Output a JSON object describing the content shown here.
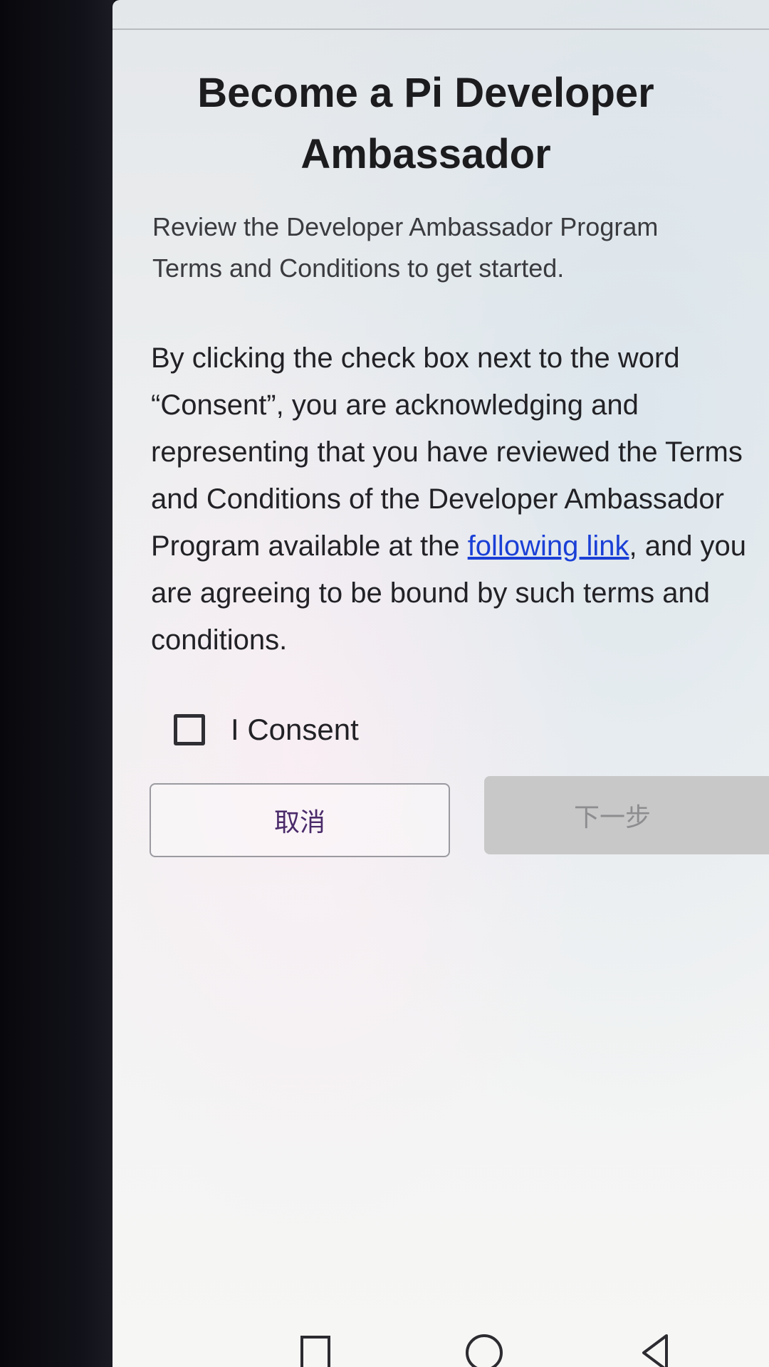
{
  "dialog": {
    "title": "Become a Pi Developer Ambassador",
    "intro": "Review the Developer Ambassador Program Terms and Conditions to get started.",
    "consent_text_before_link": "By clicking the check box next to the word “Consent”, you are acknowledging and representing that you have reviewed the Terms and Conditions of the Developer Ambassador Program available at the ",
    "link_text": "following link",
    "consent_text_after_link": ", and you are agreeing to be bound by such terms and conditions.",
    "checkbox_label": "I Consent",
    "checkbox_checked": false
  },
  "buttons": {
    "cancel_label": "取消",
    "next_label": "下一步",
    "next_enabled": false
  },
  "colors": {
    "link": "#1a3fd6",
    "title": "#1c1c1f",
    "next_disabled_bg": "#c8c8c9",
    "cancel_text": "#4a2a6a"
  },
  "nav": {
    "icons": [
      "recents-icon",
      "home-icon",
      "back-icon"
    ]
  }
}
